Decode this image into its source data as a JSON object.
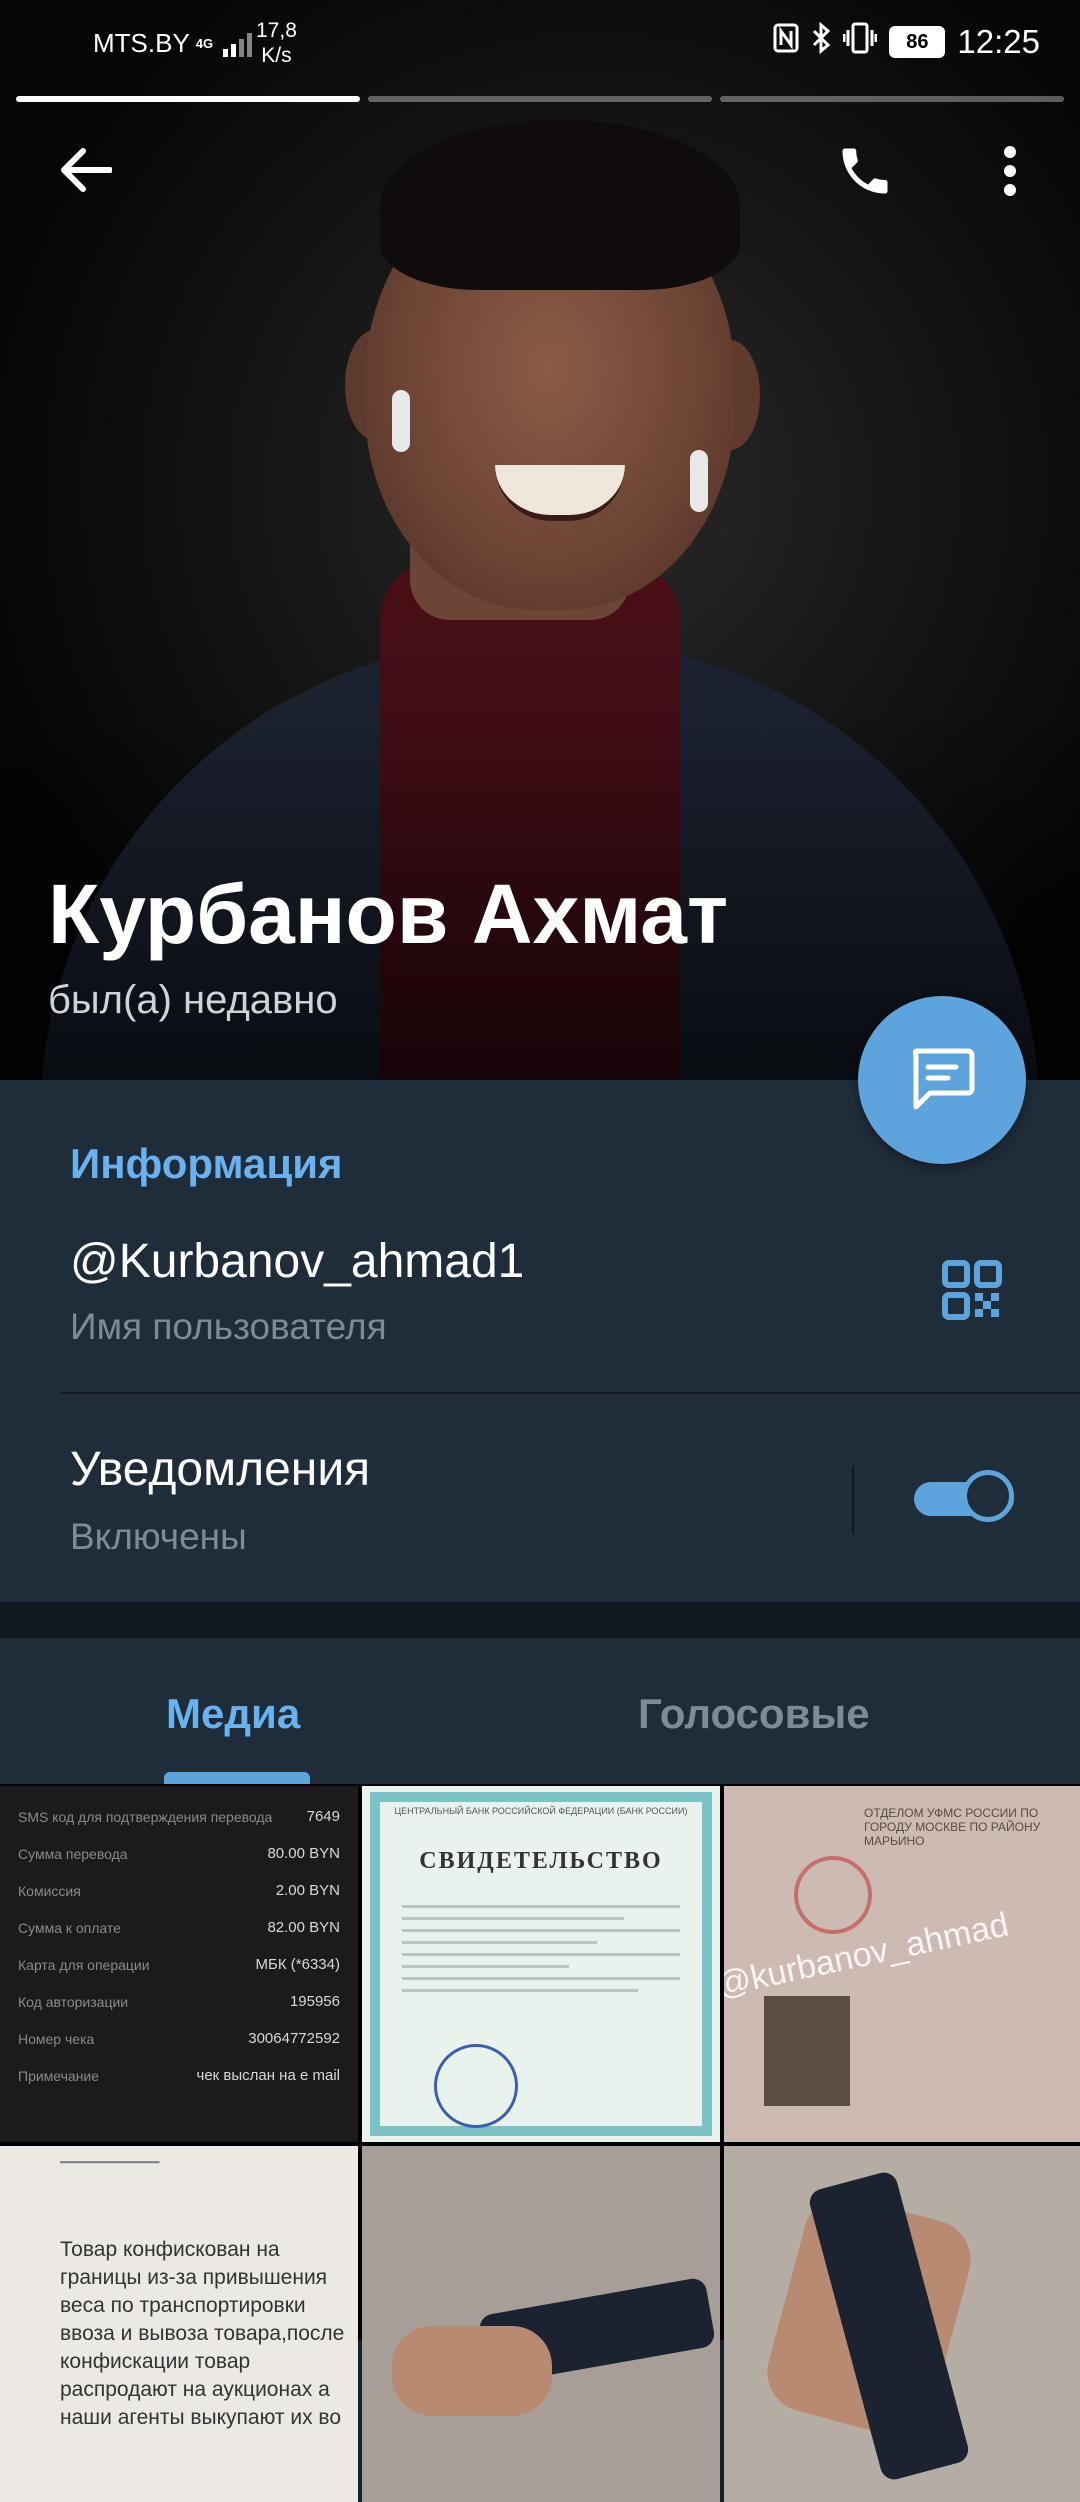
{
  "status_bar": {
    "carrier": "MTS.BY",
    "network": "4G",
    "speed_value": "17,8",
    "speed_unit": "K/s",
    "battery": "86",
    "time": "12:25",
    "icons": [
      "nfc-icon",
      "bluetooth-icon",
      "vibrate-icon"
    ]
  },
  "story_progress": {
    "count": 3,
    "active_index": 0
  },
  "profile": {
    "name": "Курбанов Ахмат",
    "last_seen": "был(а) недавно"
  },
  "info": {
    "section_title": "Информация",
    "username": "@Kurbanov_ahmad1",
    "username_caption": "Имя пользователя",
    "notifications_label": "Уведомления",
    "notifications_status": "Включены",
    "notifications_enabled": true
  },
  "tabs": [
    {
      "label": "Медиа",
      "active": true
    },
    {
      "label": "Голосовые",
      "active": false
    }
  ],
  "media": {
    "sms_receipt": [
      {
        "label": "SMS код для подтверждения перевода",
        "value": "7649"
      },
      {
        "label": "Сумма перевода",
        "value": "80.00 BYN"
      },
      {
        "label": "Комиссия",
        "value": "2.00 BYN"
      },
      {
        "label": "Сумма к оплате",
        "value": "82.00 BYN"
      },
      {
        "label": "Карта для операции",
        "value": "МБК (*6334)"
      },
      {
        "label": "Код авторизации",
        "value": "195956"
      },
      {
        "label": "Номер чека",
        "value": "30064772592"
      },
      {
        "label": "Примечание",
        "value": "чек выслан на e mail"
      }
    ],
    "certificate_header": "ЦЕНТРАЛЬНЫЙ БАНК РОССИЙСКОЙ ФЕДЕРАЦИИ (БАНК РОССИИ)",
    "certificate_title": "СВИДЕТЕЛЬСТВО",
    "passport_header": "ОТДЕЛОМ УФМС РОССИИ ПО ГОРОДУ МОСКВЕ ПО РАЙОНУ МАРЬИНО",
    "watermark": "@kurbanov_ahmad",
    "confiscation_text": "Товар конфискован на границы из-за привышения веса по транспортировки ввоза и вывоза товара,после конфискации товар распродают на аукционах а наши агенты выкупают их во"
  },
  "colors": {
    "background": "#17212b",
    "panel": "#1f2c39",
    "accent": "#5ea4dc",
    "accent_text": "#6ab2ef",
    "secondary_text": "#7d8b99"
  }
}
